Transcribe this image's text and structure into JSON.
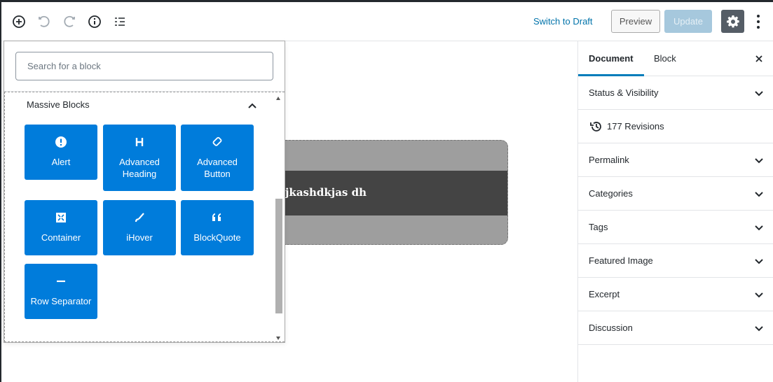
{
  "toolbar": {
    "switch_draft": "Switch to Draft",
    "preview": "Preview",
    "update": "Update"
  },
  "icons": {
    "add": "plus-circle-icon",
    "undo": "undo-icon",
    "redo": "redo-icon",
    "info": "info-icon",
    "outline": "list-view-icon",
    "settings": "gear-icon",
    "more": "more-vertical-icon"
  },
  "colors": {
    "accent": "#007cba",
    "block_tile": "#007cdb",
    "settings_bg": "#555d66",
    "update_disabled": "#a6c8dd"
  },
  "inserter": {
    "search_placeholder": "Search for a block",
    "panel_title": "Massive Blocks",
    "blocks": [
      {
        "label": "Alert",
        "icon": "alert-icon"
      },
      {
        "label": "Advanced Heading",
        "icon": "heading-icon"
      },
      {
        "label": "Advanced Button",
        "icon": "button-icon"
      },
      {
        "label": "Container",
        "icon": "container-icon"
      },
      {
        "label": "iHover",
        "icon": "brush-icon"
      },
      {
        "label": "BlockQuote",
        "icon": "quote-icon"
      },
      {
        "label": "Row Separator",
        "icon": "separator-icon"
      }
    ]
  },
  "canvas": {
    "text": "jkashdkjas dh"
  },
  "sidebar": {
    "tabs": [
      "Document",
      "Block"
    ],
    "revisions": "177 Revisions",
    "rows": [
      "Status & Visibility",
      "Permalink",
      "Categories",
      "Tags",
      "Featured Image",
      "Excerpt",
      "Discussion"
    ]
  }
}
